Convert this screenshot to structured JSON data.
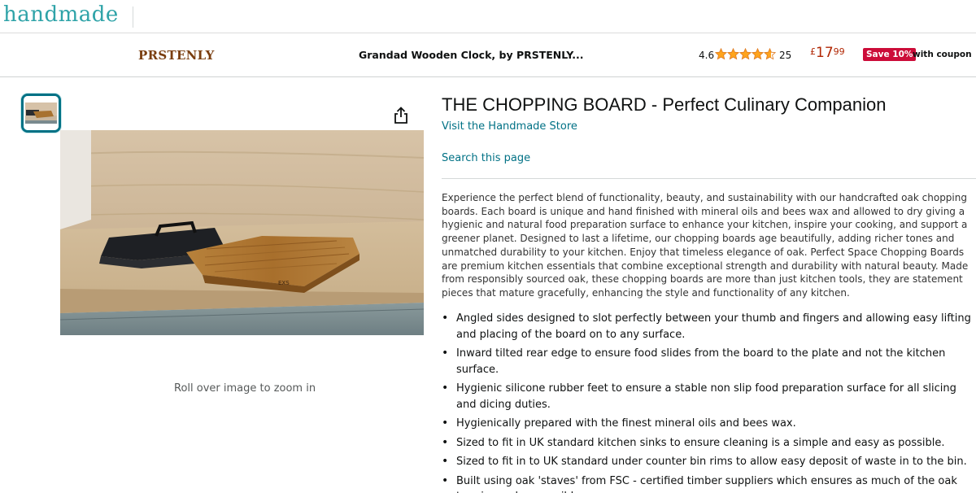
{
  "header": {
    "logo_text": "handmade"
  },
  "sticky_bar": {
    "brand": "PRSTENLY",
    "title": "Grandad Wooden Clock, by PRSTENLY...",
    "rating": "4.6",
    "rating_stars": 4.6,
    "rating_count": "25",
    "price_currency": "£",
    "price_whole": "17",
    "price_fraction": "99",
    "coupon_badge": "Save 10%",
    "coupon_text": "with coupon",
    "colors": {
      "coupon_bg": "#cc0c39",
      "price": "#b12704",
      "stars": "#ffa41c",
      "brand": "#7a3e10"
    }
  },
  "gallery": {
    "zoom_hint": "Roll over image to zoom in",
    "thumbnail_alt": "chopping-board-thumbnail",
    "share_icon": "share-icon"
  },
  "product": {
    "title": "THE CHOPPING BOARD - Perfect Culinary Companion",
    "store_link": "Visit the Handmade Store",
    "search_link": "Search this page",
    "description": "Experience the perfect blend of functionality, beauty, and sustainability with our handcrafted oak chopping boards. Each board is unique and hand finished with mineral oils and bees wax and allowed to dry giving a hygienic and natural food preparation surface to enhance your kitchen, inspire your cooking, and support a greener planet. Designed to last a lifetime, our chopping boards age beautifully, adding richer tones and unmatched durability to your kitchen. Enjoy that timeless elegance of oak. Perfect Space Chopping Boards are premium kitchen essentials that combine exceptional strength and durability with natural beauty. Made from responsibly sourced oak, these chopping boards are more than just kitchen tools, they are statement pieces that mature gracefully, enhancing the style and functionality of any kitchen.",
    "bullets": [
      "Angled sides designed to slot perfectly between your thumb and fingers and allowing easy lifting and placing of the board on to any surface.",
      "Inward tilted rear edge to ensure food slides from the board to the plate and not the kitchen surface.",
      "Hygienic silicone rubber feet to ensure a stable non slip food preparation surface for all slicing and dicing duties.",
      "Hygienically prepared with the finest mineral oils and bees wax.",
      "Sized to fit in UK standard kitchen sinks to ensure cleaning is a simple and easy as possible.",
      "Sized to fit in to UK standard under counter bin rims to allow easy deposit of waste in to the bin.",
      "Built using oak 'staves' from FSC - certified timber suppliers which ensures as much of the oak tree is used as possible."
    ],
    "colors": {
      "link": "#007185"
    }
  }
}
